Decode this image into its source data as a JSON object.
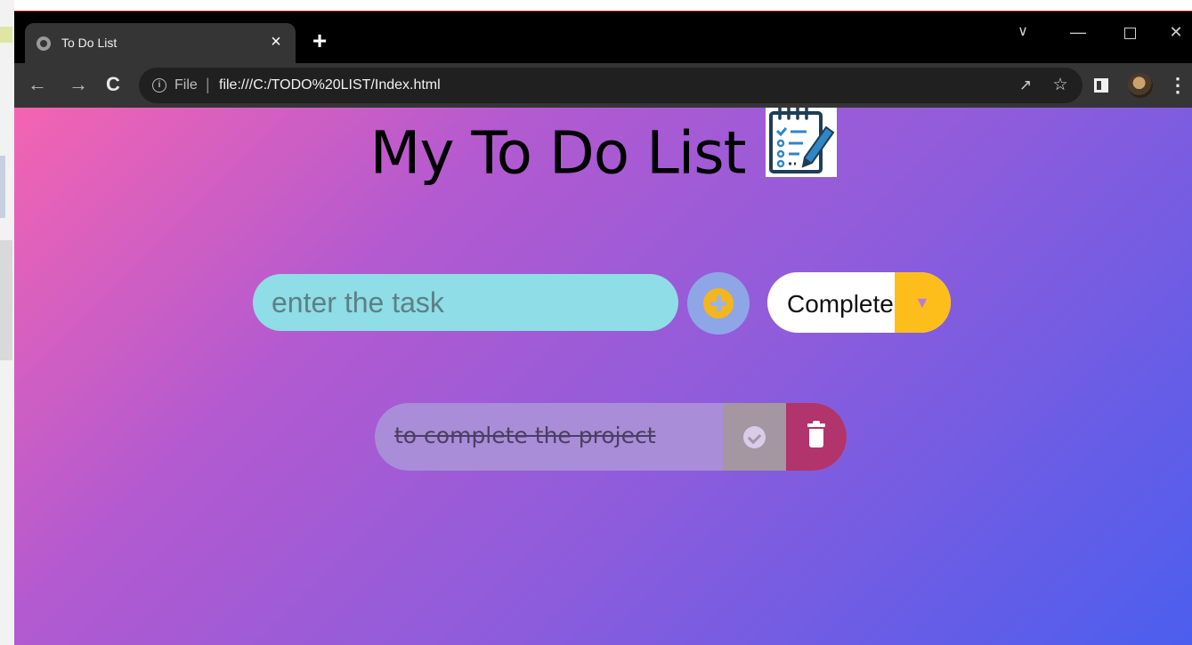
{
  "browser": {
    "tab": {
      "title": "To Do List",
      "close_glyph": "×"
    },
    "new_tab_glyph": "+",
    "window_controls": {
      "tab_search": "∨",
      "minimize": "—",
      "close": "✕"
    },
    "toolbar": {
      "back": "←",
      "forward": "→",
      "reload": "C",
      "info": "i",
      "scheme": "File",
      "separator": "|",
      "url": "file:///C:/TODO%20LIST/Index.html",
      "share": "↗",
      "bookmark": "☆",
      "menu": "⋮"
    }
  },
  "page": {
    "title": "My To Do List",
    "task_input": {
      "placeholder": "enter the task",
      "value": ""
    },
    "filter_select": {
      "selected": "Complete"
    },
    "todos": [
      {
        "text": "to complete the project",
        "completed": true
      }
    ]
  },
  "colors": {
    "gradient_start": "#f464b1",
    "gradient_end": "#4b5eee",
    "input_bg": "#8fdde6",
    "add_button_bg": "#8fa6e6",
    "plus_circle": "#f5b51e",
    "select_arrow_bg": "#fdbe1b",
    "todo_bg": "#a98dd9",
    "complete_btn_bg": "#a497a2",
    "delete_btn_bg": "#b1346c"
  },
  "icons": {
    "favicon": "globe-icon",
    "title_icon": "notepad-checklist-icon",
    "add": "plus-circle-icon",
    "complete": "check-circle-icon",
    "delete": "trash-icon"
  }
}
